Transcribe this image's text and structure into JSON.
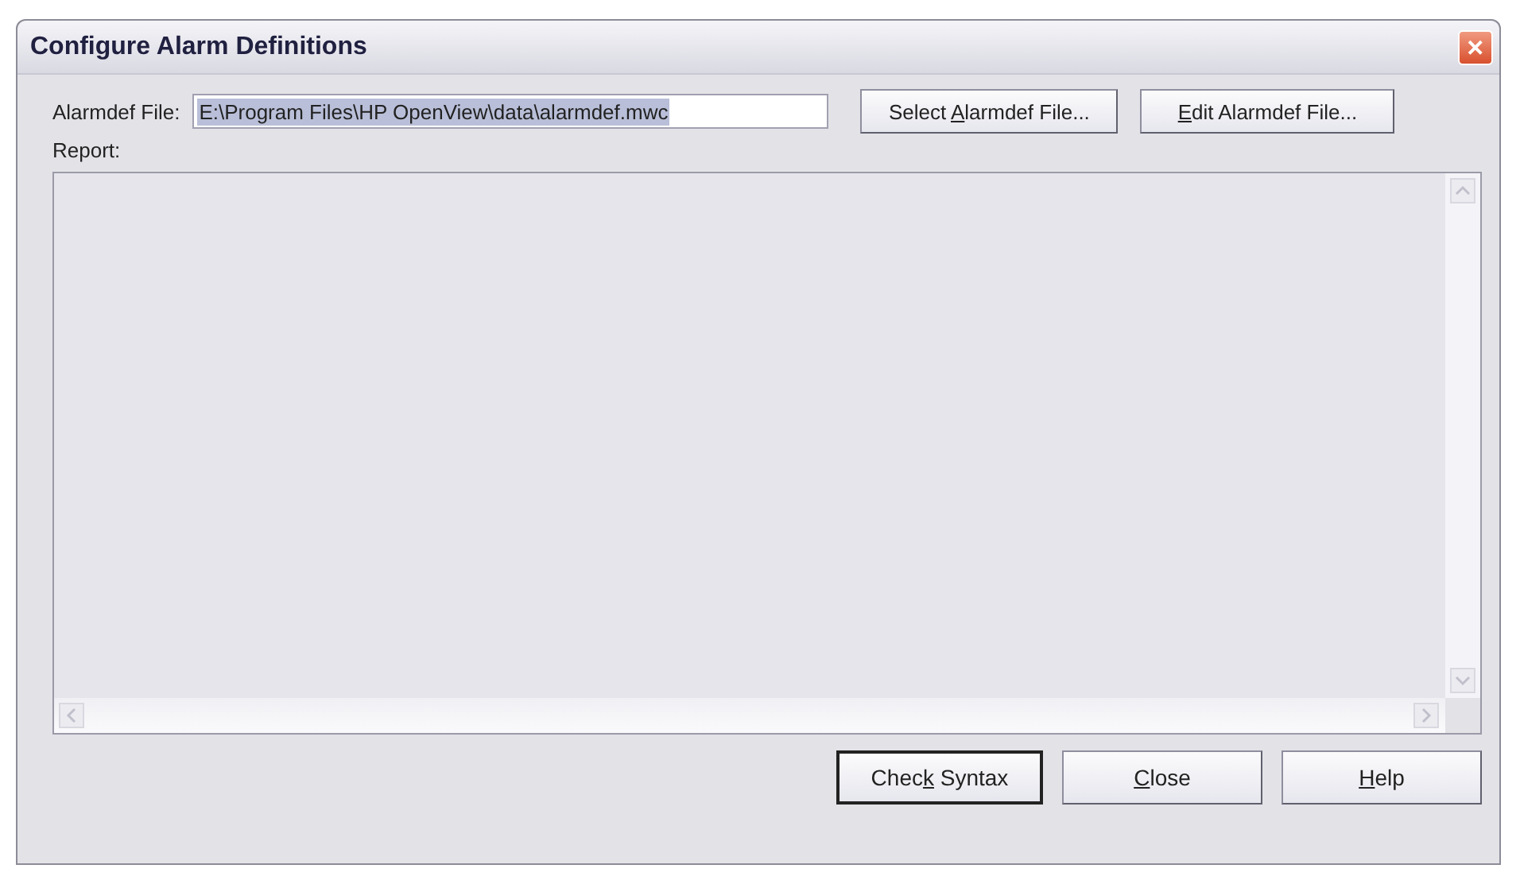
{
  "window": {
    "title": "Configure Alarm Definitions",
    "close_glyph": "✕"
  },
  "alarmdef_file": {
    "label": "Alarmdef File:",
    "value": "E:\\Program Files\\HP OpenView\\data\\alarmdef.mwc",
    "selected": true
  },
  "top_buttons": [
    {
      "before": "Select ",
      "key": "A",
      "after": "larmdef File...",
      "default": false
    },
    {
      "key": "E",
      "after": "dit Alarmdef File...",
      "default": false
    }
  ],
  "report": {
    "label": "Report:"
  },
  "bottom_buttons": [
    {
      "before": "Chec",
      "key": "k",
      "after": " Syntax",
      "default": true
    },
    {
      "key": "C",
      "after": "lose",
      "default": false
    },
    {
      "key": "H",
      "after": "elp",
      "default": false
    }
  ]
}
